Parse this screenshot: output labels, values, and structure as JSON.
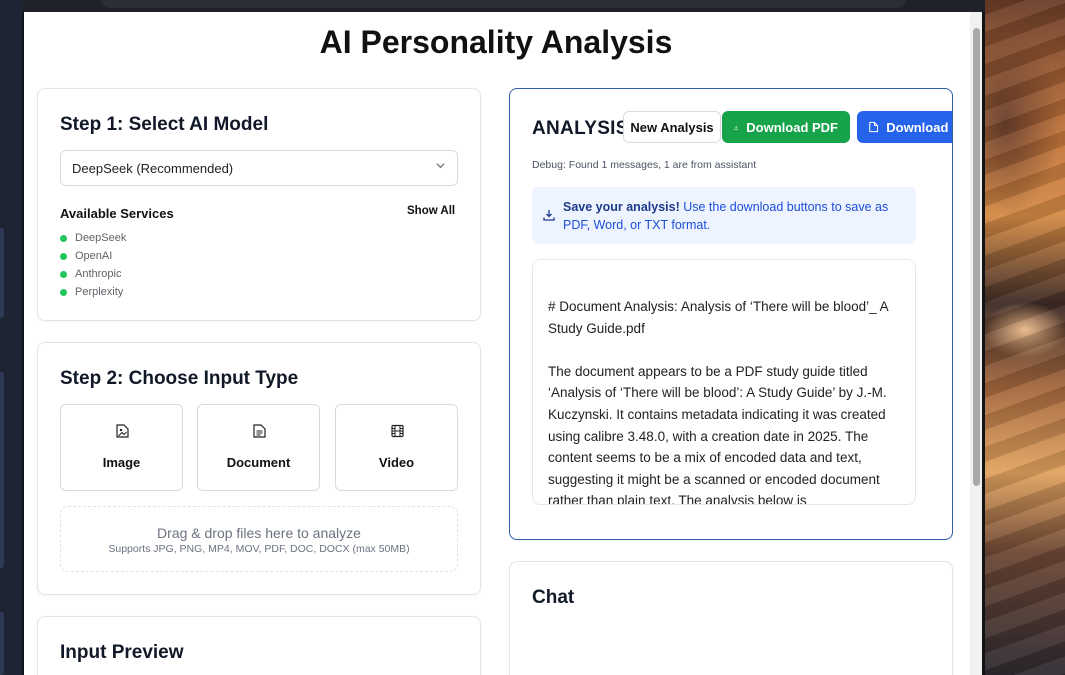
{
  "page": {
    "title": "AI Personality Analysis"
  },
  "step1": {
    "title": "Step 1: Select AI Model",
    "selected_model": "DeepSeek (Recommended)",
    "services_title": "Available Services",
    "show_all": "Show All",
    "services": [
      "DeepSeek",
      "OpenAI",
      "Anthropic",
      "Perplexity"
    ],
    "status_color": "#22c55e"
  },
  "step2": {
    "title": "Step 2: Choose Input Type",
    "types": [
      {
        "label": "Image",
        "icon": "image-file-icon"
      },
      {
        "label": "Document",
        "icon": "document-icon"
      },
      {
        "label": "Video",
        "icon": "film-icon"
      }
    ],
    "dropzone_main": "Drag & drop files here to analyze",
    "dropzone_sub": "Supports JPG, PNG, MP4, MOV, PDF, DOC, DOCX (max 50MB)"
  },
  "preview": {
    "title": "Input Preview"
  },
  "analysis": {
    "title": "ANALYSIS",
    "new_label": "New Analysis",
    "pdf_label": "Download PDF",
    "word_label": "Download Word",
    "debug": "Debug: Found 1 messages, 1 are from assistant",
    "save_bold": "Save your analysis!",
    "save_text": " Use the download buttons to save as PDF, Word, or TXT format.",
    "content_heading": "# Document Analysis: Analysis of ‘There will be blood’_ A Study Guide.pdf",
    "content_para": "The document appears to be a PDF study guide titled ‘Analysis of ‘There will be blood’: A Study Guide’ by J.-M. Kuczynski. It contains metadata indicating it was created using calibre 3.48.0, with a creation date in 2025. The content seems to be a mix of encoded data and text, suggesting it might be a scanned or encoded document rather than plain text. The analysis below is",
    "accent_green": "#16a34a",
    "accent_blue": "#2563eb"
  },
  "chat": {
    "title": "Chat"
  }
}
